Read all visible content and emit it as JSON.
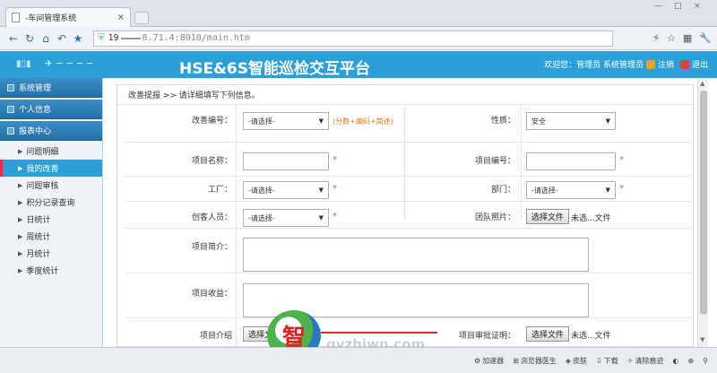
{
  "browser": {
    "tab_title": "-车间管理系统",
    "tab_close": "×",
    "url_prefix": "19",
    "url_rest": "8.71.4:8010/main.htm",
    "window_controls": [
      "—",
      "□",
      "×"
    ]
  },
  "header": {
    "plane_deco": "✈ ─ ─ ─ ─",
    "title": "HSE&6S智能巡检交互平台",
    "welcome": "欢迎您：管理员 系统管理员",
    "logout": "注销",
    "exit": "退出"
  },
  "sidebar": {
    "sections": [
      {
        "label": "系统管理"
      },
      {
        "label": "个人信息"
      },
      {
        "label": "报表中心"
      }
    ],
    "items": [
      {
        "label": "问题明细"
      },
      {
        "label": "我的改善"
      },
      {
        "label": "问题审核"
      },
      {
        "label": "积分记录查询"
      },
      {
        "label": "日统计"
      },
      {
        "label": "周统计"
      },
      {
        "label": "月统计"
      },
      {
        "label": "季度统计"
      }
    ]
  },
  "main": {
    "breadcrumb": "改善提报 >> 请详细填写下列信息。",
    "form": {
      "improve_no_label": "改善编号：",
      "improve_no_value": "-请选择-",
      "improve_no_note": "(分数+编码+简述)",
      "nature_label": "性质：",
      "nature_value": "安全",
      "project_name_label": "项目名称：",
      "project_no_label": "项目编号：",
      "factory_label": "工厂：",
      "factory_value": "-请选择-",
      "dept_label": "部门：",
      "dept_value": "-请选择-",
      "creator_label": "创客人员：",
      "creator_value": "-请选择-",
      "team_photo_label": "团队照片：",
      "choose_file": "选择文件",
      "no_file": "未选...文件",
      "intro_label": "项目简介：",
      "benefit_label": "项目收益：",
      "project_intro_label": "项目介绍",
      "approval_label": "项目审批证明：",
      "required_mark": "*"
    }
  },
  "statusbar": {
    "items": [
      "加速器",
      "浏览器医生",
      "皮肤",
      "下载",
      "清除痕迹"
    ]
  },
  "watermark": {
    "char": "智",
    "text": "gyzhiwn.com"
  },
  "colors": {
    "header_bg": "#2a9fd8",
    "sidebar_section": "#2670a8",
    "active_item": "#2a9fd8",
    "required": "#e55555",
    "note": "#e07b1a"
  }
}
